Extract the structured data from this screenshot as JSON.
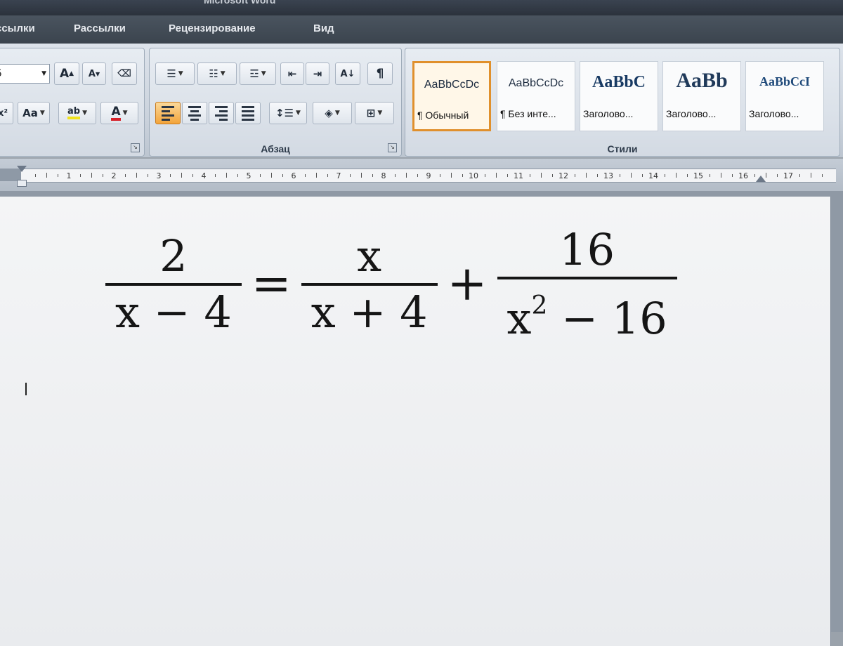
{
  "window": {
    "title": "Microsoft Word"
  },
  "tabs": [
    {
      "label": "ссылки"
    },
    {
      "label": "Рассылки"
    },
    {
      "label": "Рецензирование"
    },
    {
      "label": "Вид"
    }
  ],
  "ribbon": {
    "font_group": {
      "font_size_value": "5",
      "grow_font": "A",
      "shrink_font": "A",
      "change_case": "Aa",
      "highlight": "ab",
      "font_color": "A"
    },
    "paragraph_group": {
      "label": "Абзац"
    },
    "styles_group": {
      "label": "Стили",
      "styles": [
        {
          "sample": "AaBbCcDc",
          "name": "¶ Обычный"
        },
        {
          "sample": "AaBbCcDc",
          "name": "¶ Без инте..."
        },
        {
          "sample": "AaBbC",
          "name": "Заголово..."
        },
        {
          "sample": "AaBb",
          "name": "Заголово..."
        },
        {
          "sample": "AaBbCcI",
          "name": "Заголово..."
        }
      ]
    }
  },
  "ruler": {
    "ticks": [
      "1",
      "2",
      "3",
      "4",
      "5",
      "6",
      "7",
      "8",
      "9",
      "10",
      "11",
      "12",
      "13",
      "14",
      "15",
      "16",
      "17"
    ]
  },
  "equation": {
    "lhs_numerator": "2",
    "lhs_denominator": "x − 4",
    "equals": "=",
    "term1_numerator": "x",
    "term1_denominator": "x + 4",
    "plus": "+",
    "term2_numerator": "16",
    "term2_denominator_base": "x",
    "term2_denominator_exp": "2",
    "term2_denominator_rest": " − 16"
  }
}
